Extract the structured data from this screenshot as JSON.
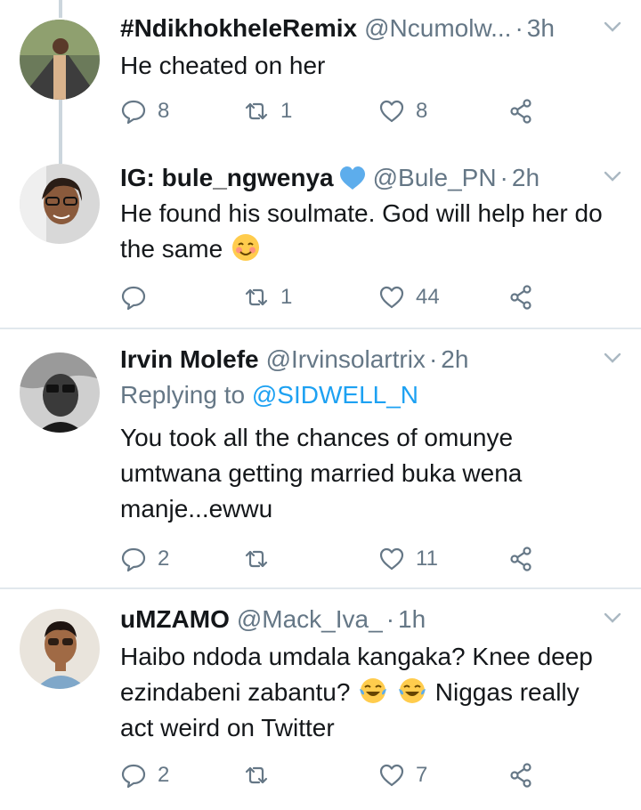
{
  "colors": {
    "text": "#14171a",
    "secondary": "#657786",
    "accent": "#1da1f2",
    "divider": "#e1e8ed",
    "thread": "#ccd6dd"
  },
  "tweets": [
    {
      "name": "#NdikhokheleRemix",
      "handle": "@Ncumolw...",
      "dot": "·",
      "time": "3h",
      "text": "He cheated on her",
      "replies": "8",
      "retweets": "1",
      "likes": "8"
    },
    {
      "name": "IG: bule_ngwenya",
      "verified_icon": "blue-heart-icon",
      "handle": "@Bule_PN",
      "dot": "·",
      "time": "2h",
      "text": "He found his soulmate. God will help her do the same",
      "emoji": "smiling-face-icon",
      "replies": "",
      "retweets": "1",
      "likes": "44"
    },
    {
      "name": "Irvin Molefe",
      "handle": "@Irvinsolartrix",
      "dot": "·",
      "time": "2h",
      "replying_prefix": "Replying to",
      "replying_to": "@SIDWELL_N",
      "text": "You took all the chances of omunye umtwana getting married buka wena manje...ewwu",
      "replies": "2",
      "retweets": "",
      "likes": "11"
    },
    {
      "name": "uMZAMO",
      "handle": "@Mack_Iva_",
      "dot": "·",
      "time": "1h",
      "text_before": "Haibo ndoda umdala kangaka? Knee deep ezindabeni zabantu?",
      "emoji": "face-with-tears-of-joy-icon",
      "text_after": "Niggas really act weird on Twitter",
      "replies": "2",
      "retweets": "",
      "likes": "7"
    }
  ]
}
